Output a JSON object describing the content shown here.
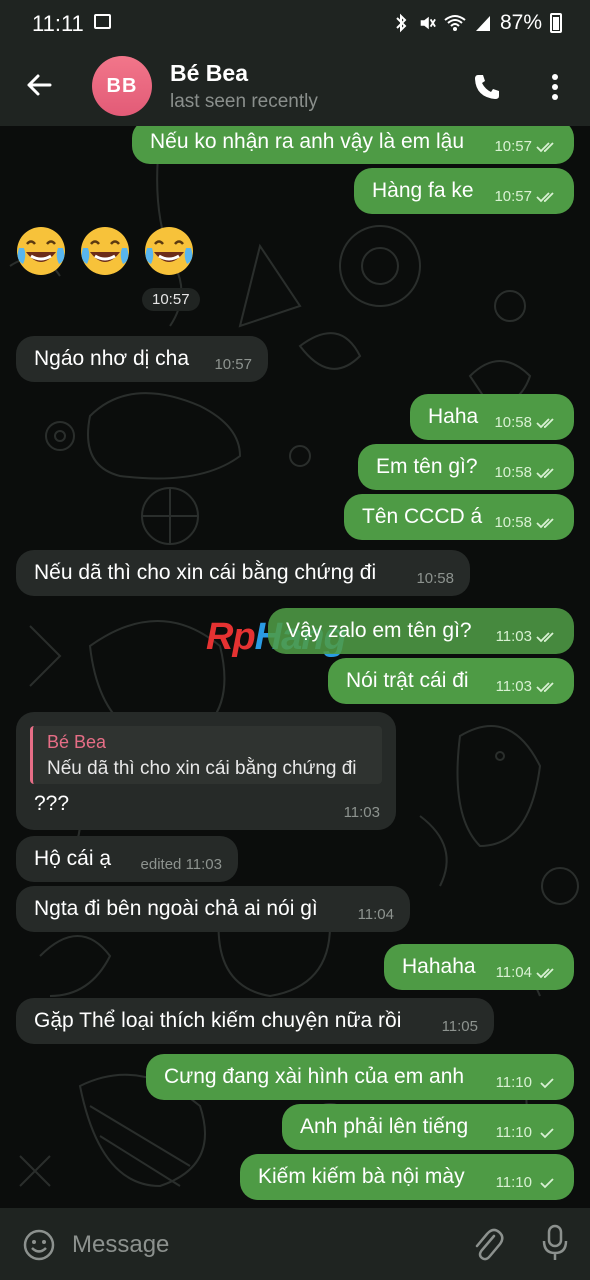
{
  "status_bar": {
    "time": "11:11",
    "battery": "87%"
  },
  "header": {
    "avatar_initials": "BB",
    "name": "Bé Bea",
    "status": "last seen recently"
  },
  "messages": [
    {
      "dir": "out",
      "text": "Nếu ko nhận ra anh vậy là em lậu",
      "time": "10:57",
      "check": "double"
    },
    {
      "dir": "out",
      "text": "Hàng fa ke",
      "time": "10:57",
      "check": "double"
    },
    {
      "dir": "in",
      "text": "Ngáo nhơ dị cha",
      "time": "10:57"
    },
    {
      "dir": "out",
      "text": "Haha",
      "time": "10:58",
      "check": "double"
    },
    {
      "dir": "out",
      "text": "Em tên gì?",
      "time": "10:58",
      "check": "double"
    },
    {
      "dir": "out",
      "text": "Tên CCCD á",
      "time": "10:58",
      "check": "double"
    },
    {
      "dir": "in",
      "text": "Nếu dã thì cho xin cái bằng chứng đi",
      "time": "10:58"
    },
    {
      "dir": "out",
      "text": "Vậy zalo em tên gì?",
      "time": "11:03",
      "check": "double"
    },
    {
      "dir": "out",
      "text": "Nói trật cái đi",
      "time": "11:03",
      "check": "double"
    },
    {
      "dir": "in",
      "text": "???",
      "time": "11:03"
    },
    {
      "dir": "in",
      "text": "Hộ cái ạ",
      "time": "edited 11:03"
    },
    {
      "dir": "in",
      "text": "Ngta đi bên ngoài chả ai nói gì",
      "time": "11:04"
    },
    {
      "dir": "out",
      "text": "Hahaha",
      "time": "11:04",
      "check": "double"
    },
    {
      "dir": "in",
      "text": "Gặp Thể loại thích kiếm chuyện nữa rồi",
      "time": "11:05"
    },
    {
      "dir": "out",
      "text": "Cưng đang xài hình của em anh",
      "time": "11:10",
      "check": "single"
    },
    {
      "dir": "out",
      "text": "Anh phải lên tiếng",
      "time": "11:10",
      "check": "single"
    },
    {
      "dir": "out",
      "text": "Kiếm kiếm bà nội mày",
      "time": "11:10",
      "check": "single"
    }
  ],
  "emoji_message": {
    "emoji": "face-with-tears-of-joy",
    "count": 3,
    "time": "10:57"
  },
  "reply_quote": {
    "name": "Bé Bea",
    "text": "Nếu dã thì cho xin cái bằng chứng đi"
  },
  "watermark": {
    "part1": "R",
    "part2": "p",
    "part3": "Hang"
  },
  "composer": {
    "placeholder": "Message"
  },
  "colors": {
    "outgoing_bubble": "#4e9b45",
    "incoming_bubble": "#262a28",
    "accent_pink": "#e66e86",
    "background": "#0b0d0c"
  }
}
